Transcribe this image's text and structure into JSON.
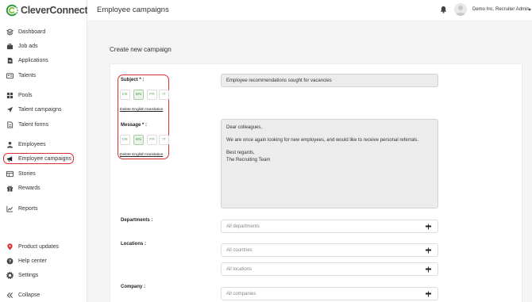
{
  "brand": {
    "name": "CleverConnect"
  },
  "sidebar": {
    "items": [
      {
        "label": "Dashboard",
        "icon": "layers-icon"
      },
      {
        "label": "Job ads",
        "icon": "briefcase-icon"
      },
      {
        "label": "Applications",
        "icon": "document-icon"
      },
      {
        "label": "Talents",
        "icon": "id-card-icon"
      },
      {
        "label": "Pools",
        "icon": "grid-icon"
      },
      {
        "label": "Talent campaigns",
        "icon": "send-icon"
      },
      {
        "label": "Talent forms",
        "icon": "form-icon"
      },
      {
        "label": "Employees",
        "icon": "person-icon"
      },
      {
        "label": "Employee campaigns",
        "icon": "megaphone-icon",
        "active": true
      },
      {
        "label": "Stories",
        "icon": "stories-icon"
      },
      {
        "label": "Rewards",
        "icon": "gift-icon"
      },
      {
        "label": "Reports",
        "icon": "chart-icon"
      },
      {
        "label": "Product updates",
        "icon": "pin-icon"
      },
      {
        "label": "Help center",
        "icon": "help-icon"
      },
      {
        "label": "Settings",
        "icon": "gear-icon"
      },
      {
        "label": "Collapse",
        "icon": "double-chevron-left-icon"
      }
    ]
  },
  "header": {
    "title": "Employee campaigns",
    "user_name": "Demo Inc. Recruiter Admin"
  },
  "main": {
    "section_title": "Create new campaign",
    "subject": {
      "label": "Subject * :",
      "languages": [
        "DE",
        "EN",
        "FR",
        "IT"
      ],
      "active_language": "EN",
      "delete_link": "Delete English translation",
      "value": "Employee recommendations sought for vacancies"
    },
    "message": {
      "label": "Message * :",
      "languages": [
        "DE",
        "EN",
        "FR",
        "IT"
      ],
      "active_language": "EN",
      "delete_link": "Delete English translation",
      "lines": [
        "Dear colleagues,",
        "We are once again looking for new employees, and would like to receive personal referrals.",
        "Best regards,",
        "The Recruiting Team"
      ]
    },
    "departments": {
      "label": "Departments :",
      "placeholder": "All departments"
    },
    "locations": {
      "label": "Locations :",
      "countries_placeholder": "All countries",
      "locations_placeholder": "All locations"
    },
    "company": {
      "label": "Company :",
      "placeholder": "All companies"
    }
  },
  "colors": {
    "accent_green": "#3f8a3c",
    "highlight_red": "#d9302f"
  }
}
